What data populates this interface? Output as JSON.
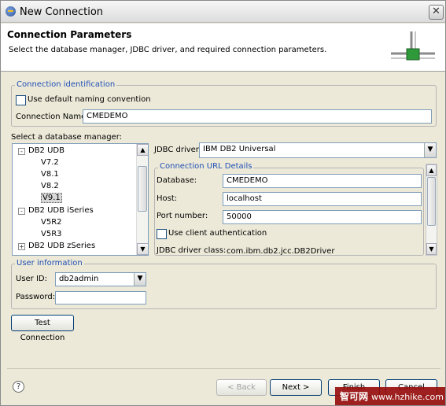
{
  "window": {
    "title": "New Connection"
  },
  "header": {
    "title": "Connection Parameters",
    "description": "Select the database manager, JDBC driver, and required connection parameters."
  },
  "connection_identification": {
    "legend": "Connection identification",
    "use_default_label": "Use default naming convention",
    "use_default_checked": false,
    "name_label": "Connection Name:",
    "name_value": "CMEDEMO"
  },
  "db_manager": {
    "label": "Select a database manager:",
    "tree": [
      {
        "label": "DB2 UDB",
        "expander": "-"
      },
      {
        "label": "V7.2"
      },
      {
        "label": "V8.1"
      },
      {
        "label": "V8.2"
      },
      {
        "label": "V9.1",
        "selected": true
      },
      {
        "label": "DB2 UDB iSeries",
        "expander": "-"
      },
      {
        "label": "V5R2"
      },
      {
        "label": "V5R3"
      },
      {
        "label": "DB2 UDB zSeries",
        "expander": "+"
      }
    ]
  },
  "jdbc": {
    "driver_label": "JDBC driver:",
    "driver_value": "IBM DB2 Universal",
    "details_legend": "Connection URL Details",
    "database_label": "Database:",
    "database_value": "CMEDEMO",
    "host_label": "Host:",
    "host_value": "localhost",
    "port_label": "Port number:",
    "port_value": "50000",
    "client_auth_label": "Use client authentication",
    "client_auth_checked": false,
    "driver_class_label": "JDBC driver class:",
    "driver_class_value": "com.ibm.db2.jcc.DB2Driver"
  },
  "user_information": {
    "legend": "User information",
    "user_id_label": "User ID:",
    "user_id_value": "db2admin",
    "password_label": "Password:",
    "password_value": ""
  },
  "buttons": {
    "test_connection": "Test Connection",
    "back": "< Back",
    "next": "Next >",
    "finish": "Finish",
    "cancel": "Cancel"
  },
  "icons": {
    "help": "?",
    "close": "✕",
    "dropdown": "▼",
    "scroll_up": "▲",
    "scroll_down": "▼"
  },
  "watermark": {
    "brand": "智可网",
    "url": "www.hzhike.com"
  }
}
